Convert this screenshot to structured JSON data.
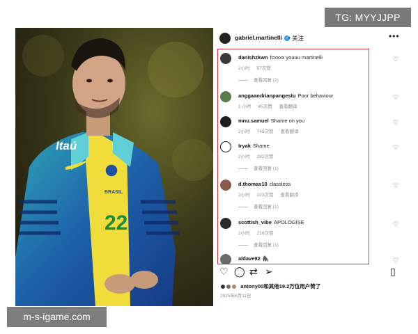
{
  "watermarks": {
    "top": "TG: MYYJJPP",
    "bottom": "m-s-igame.com"
  },
  "photo": {
    "jersey_sponsor": "Itaú",
    "jersey_text": "BRASIL",
    "jersey_number": "22",
    "next_icon": "chevron-right-icon"
  },
  "post": {
    "username": "gabriel.martinelli",
    "verified_icon": "verified-badge-icon",
    "separator": "•",
    "follow_label": "关注",
    "more_icon": "more-icon"
  },
  "comments": [
    {
      "username": "danishzkwn",
      "text": "fcxxxx youuu martinelli",
      "time": "2小时",
      "likes": "57次赞",
      "translate": "",
      "replies": "查看回复 (2)"
    },
    {
      "username": "anggaandrianpangestu",
      "text": "Poor behaviour",
      "time": "1 小时",
      "likes": "45次赞",
      "translate": "查看翻译",
      "replies": ""
    },
    {
      "username": "mnu.samuel",
      "text": "Shame on you",
      "time": "2小时",
      "likes": "749次赞",
      "translate": "查看翻译",
      "replies": ""
    },
    {
      "username": "tryak",
      "text": "Shame",
      "time": "2小时",
      "likes": "282次赞",
      "translate": "",
      "replies": "查看回复 (1)"
    },
    {
      "username": "d.thomas10",
      "text": "classless",
      "time": "2小时",
      "likes": "123次赞",
      "translate": "查看翻译",
      "replies": "查看回复 (1)"
    },
    {
      "username": "scottish_vibe",
      "text": "APOLOGISE",
      "time": "2小时",
      "likes": "216次赞",
      "translate": "",
      "replies": "查看回复 (1)"
    },
    {
      "username": "aldave92",
      "text": "🦍",
      "time": "",
      "likes": "",
      "translate": "",
      "replies": ""
    }
  ],
  "likes_summary": "antony00和其他19.2万位用户赞了",
  "post_date": "2025年6月11日",
  "colors": {
    "highlight_border": "#d9313a",
    "verified_blue": "#3897f0",
    "meta_gray": "#8e8e8e"
  }
}
